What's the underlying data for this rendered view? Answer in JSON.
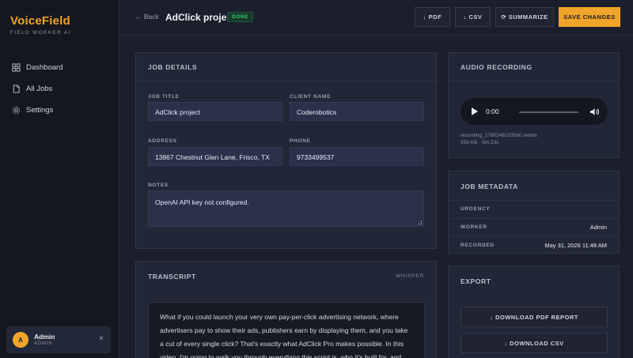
{
  "app": {
    "name": "VoiceField",
    "tagline": "FIELD WORKER AI"
  },
  "sidebar": {
    "items": [
      {
        "label": "Dashboard",
        "icon": "grid-icon"
      },
      {
        "label": "All Jobs",
        "icon": "document-icon"
      },
      {
        "label": "Settings",
        "icon": "gear-icon"
      }
    ]
  },
  "user": {
    "initial": "A",
    "name": "Admin",
    "role": "ADMIN",
    "close": "×"
  },
  "header": {
    "back": "← Back",
    "title": "AdClick project",
    "status": "DONE",
    "buttons": {
      "pdf": "↓ PDF",
      "csv": "↓ CSV",
      "summarize": "⟳ SUMMARIZE",
      "save": "SAVE CHANGES"
    }
  },
  "job_details": {
    "title": "JOB DETAILS",
    "job_title_label": "JOB TITLE",
    "job_title": "AdClick project",
    "client_label": "CLIENT NAME",
    "client": "Coderobotics",
    "address_label": "ADDRESS",
    "address": "13867 Chestnut Glen Lane, Frisco, TX",
    "phone_label": "PHONE",
    "phone": "9733499537",
    "notes_label": "NOTES",
    "notes": "OpenAI API key not configured."
  },
  "transcript": {
    "title": "TRANSCRIPT",
    "engine": "WHISPER",
    "text": "What if you could launch your very own pay-per-click advertising network, where advertisers pay to show their ads, publishers earn by displaying them, and you take a cut of every single click? That's exactly what AdClick Pro makes possible. In this video, I'm going to walk you through everything this script is, who it's built for, and"
  },
  "audio": {
    "title": "AUDIO RECORDING",
    "time": "0:00",
    "filename": "recording_1780246103560.webm",
    "info": "358 KB · 0m 23s"
  },
  "metadata": {
    "title": "JOB METADATA",
    "rows": [
      {
        "key": "URGENCY",
        "value": ""
      },
      {
        "key": "WORKER",
        "value": "Admin"
      },
      {
        "key": "RECORDED",
        "value": "May 31, 2026 11:48 AM"
      }
    ]
  },
  "export": {
    "title": "EXPORT",
    "pdf": "↓ DOWNLOAD PDF REPORT",
    "csv": "↓ DOWNLOAD CSV"
  },
  "colors": {
    "accent": "#f0a429",
    "success": "#35c97b",
    "background": "#1b1f2c",
    "panel": "#222737"
  }
}
